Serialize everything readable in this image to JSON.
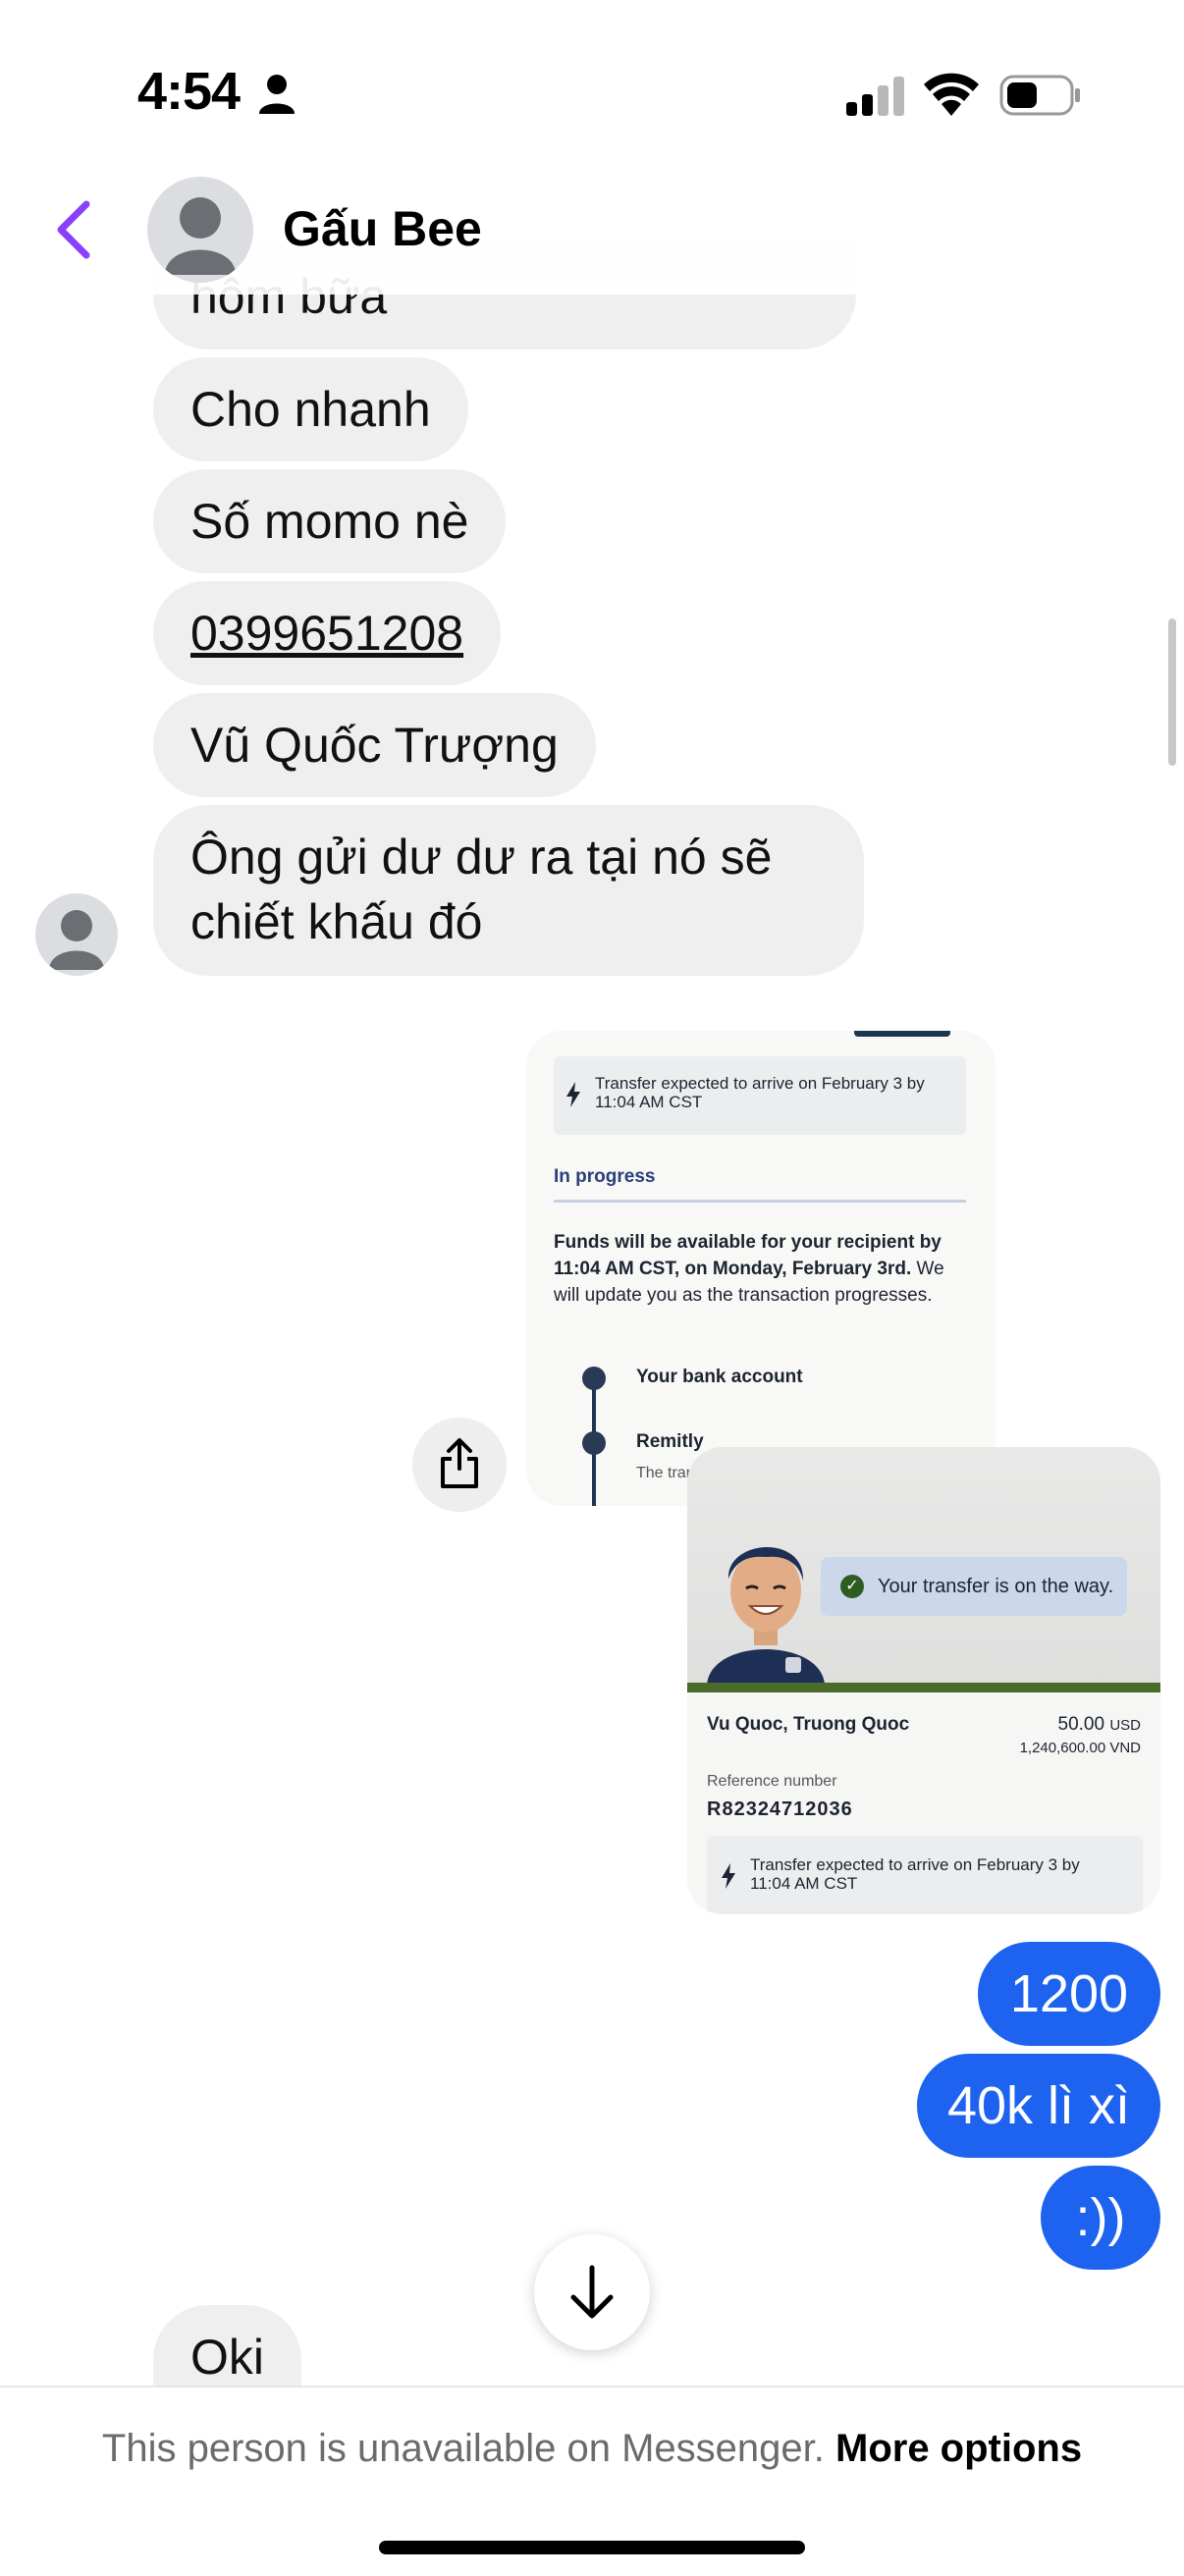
{
  "status_bar": {
    "time": "4:54"
  },
  "header": {
    "contact_name": "Gấu Bee"
  },
  "messages_in": [
    {
      "text": "hôm bữa"
    },
    {
      "text": "Cho nhanh"
    },
    {
      "text": "Số momo nè"
    },
    {
      "text": "0399651208"
    },
    {
      "text": "Vũ Quốc Trượng"
    },
    {
      "text": "Ông gửi dư dư ra tại nó sẽ chiết khấu đó"
    }
  ],
  "screenshot1": {
    "expected": "Transfer expected to arrive on February 3 by 11:04 AM CST",
    "progress_label": "In progress",
    "funds_bold": "Funds will be available for your recipient by 11:04 AM CST, on Monday, February 3rd.",
    "funds_rest": " We will update you as the transaction progresses.",
    "step1": "Your bank account",
    "step2": "Remitly",
    "step2_sub": "The transfer from your bank is underway"
  },
  "screenshot2": {
    "banner": "Your transfer is on the way.",
    "recipient": "Vu Quoc, Truong Quoc",
    "amount": "50.00",
    "amount_currency": "USD",
    "amount_converted": "1,240,600.00 VND",
    "ref_label": "Reference number",
    "ref_number": "R82324712036",
    "expected": "Transfer expected to arrive on February 3 by 11:04 AM CST"
  },
  "messages_out": [
    {
      "text": "1200"
    },
    {
      "text": "40k lì xì"
    },
    {
      "text": ":))"
    }
  ],
  "last_in": {
    "text": "Oki"
  },
  "footer": {
    "unavailable": "This person is unavailable on Messenger.",
    "more_options": "More options"
  },
  "colors": {
    "accent": "#8a3ffc",
    "out_bubble": "#1d63f0",
    "in_bubble": "#efefef"
  }
}
